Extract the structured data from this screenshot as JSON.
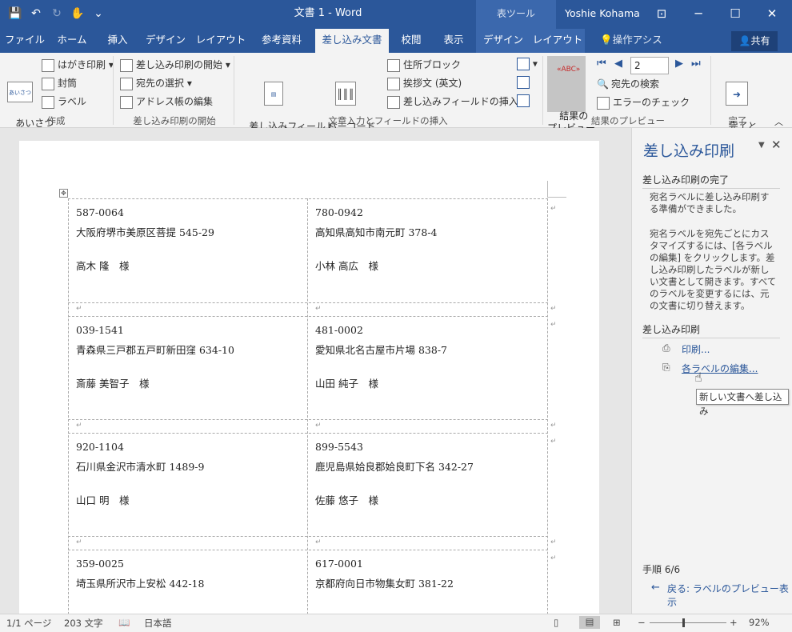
{
  "window": {
    "doc_title": "文書 1 - Word",
    "context_tools": "表ツール",
    "user": "Yoshie Kohama"
  },
  "tabs": [
    "ファイル",
    "ホーム",
    "挿入",
    "デザイン",
    "レイアウト",
    "参考資料",
    "差し込み文書",
    "校閲",
    "表示",
    "デザイン",
    "レイアウト",
    "操作アシスト"
  ],
  "share_label": "共有",
  "ribbon": {
    "aisatsu": "あいさつ\n文",
    "hagaki": "はがき印刷",
    "futo": "封筒",
    "label": "ラベル",
    "group_create": "作成",
    "start_merge": "差し込み印刷の開始",
    "select_recipients": "宛先の選択",
    "edit_address": "アドレス帳の編集",
    "group_start": "差し込み印刷の開始",
    "highlight_fields": "差し込みフィールド\nの強調表示",
    "barcode_field": "バーコード\nフィールドの挿入",
    "address_block": "住所ブロック",
    "greeting_line": "挨拶文 (英文)",
    "insert_merge_field": "差し込みフィールドの挿入",
    "group_insert": "文章入力とフィールドの挿入",
    "preview_results": "結果の\nプレビュー",
    "record_number": "2",
    "find_recipient": "宛先の検索",
    "check_errors": "エラーのチェック",
    "group_preview": "結果のプレビュー",
    "finish_merge": "完了と\n差し込み",
    "group_finish": "完了"
  },
  "labels": [
    {
      "zip": "587-0064",
      "addr": "大阪府堺市美原区菩提 545-29",
      "name": "高木 隆　様"
    },
    {
      "zip": "780-0942",
      "addr": "高知県高知市南元町 378-4",
      "name": "小林 高広　様"
    },
    {
      "zip": "039-1541",
      "addr": "青森県三戸郡五戸町新田窪 634-10",
      "name": "斎藤 美智子　様"
    },
    {
      "zip": "481-0002",
      "addr": "愛知県北名古屋市片場 838-7",
      "name": "山田 純子　様"
    },
    {
      "zip": "920-1104",
      "addr": "石川県金沢市清水町 1489-9",
      "name": "山口 明　様"
    },
    {
      "zip": "899-5543",
      "addr": "鹿児島県姶良郡姶良町下名 342-27",
      "name": "佐藤 悠子　様"
    },
    {
      "zip": "359-0025",
      "addr": "埼玉県所沢市上安松 442-18",
      "name": ""
    },
    {
      "zip": "617-0001",
      "addr": "京都府向日市物集女町 381-22",
      "name": ""
    }
  ],
  "pane": {
    "title": "差し込み印刷",
    "section1": "差し込み印刷の完了",
    "text1": "宛名ラベルに差し込み印刷する準備ができました。",
    "text2": "宛名ラベルを宛先ごとにカスタマイズするには、[各ラベルの編集] をクリックします。差し込み印刷したラベルが新しい文書として開きます。すべてのラベルを変更するには、元の文書に切り替えます。",
    "section2": "差し込み印刷",
    "print_link": "印刷...",
    "edit_link": "各ラベルの編集...",
    "tooltip": "新しい文書へ差し込み",
    "step": "手順 6/6",
    "back_link": "戻る: ラベルのプレビュー表示"
  },
  "status": {
    "page": "1/1 ページ",
    "words": "203 文字",
    "lang": "日本語",
    "zoom": "92%"
  },
  "colors": {
    "accent": "#2b579a"
  }
}
